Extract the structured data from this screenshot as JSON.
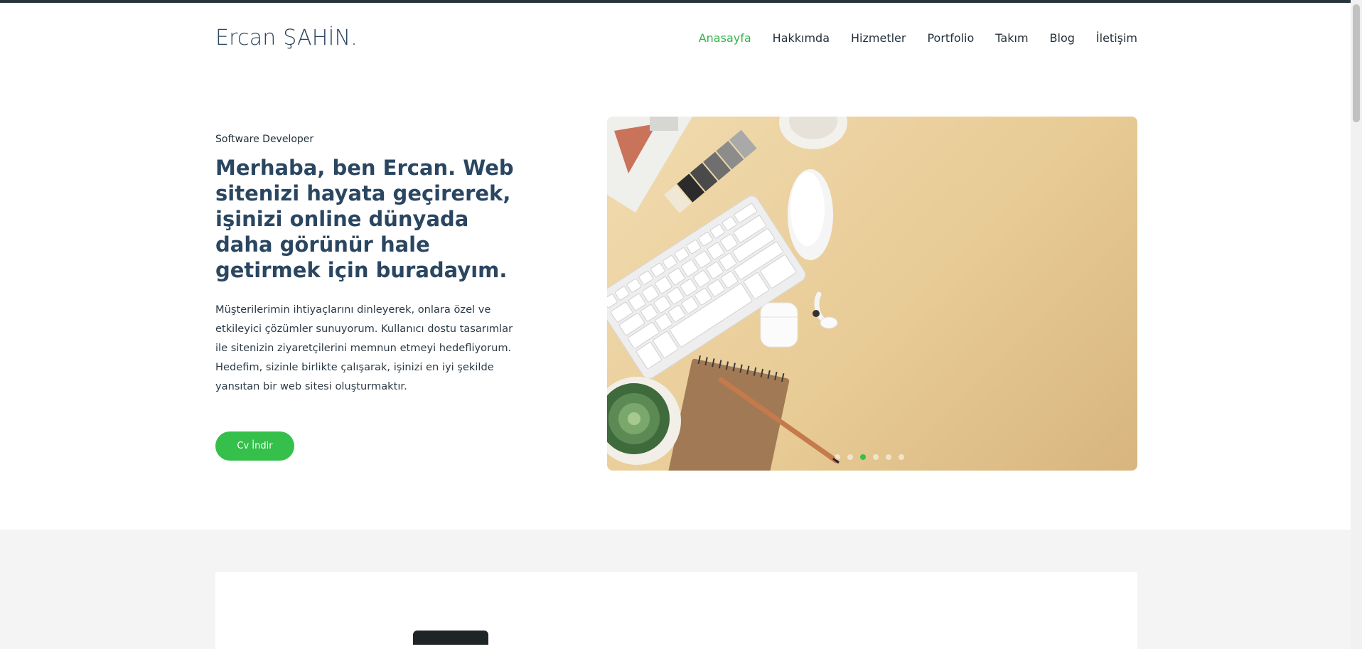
{
  "brand": "Ercan ŞAHİN.",
  "nav": {
    "items": [
      "Anasayfa",
      "Hakkımda",
      "Hizmetler",
      "Portfolio",
      "Takım",
      "Blog",
      "İletişim"
    ],
    "active": "Anasayfa"
  },
  "hero": {
    "subtitle": "Software Developer",
    "headline": "Merhaba, ben Ercan. Web sitenizi hayata geçirerek, işinizi online dünyada daha görünür hale getirmek için buradayım.",
    "lead": "Müşterilerimin ihtiyaçlarını dinleyerek, onlara özel ve etkileyici çözümler sunuyorum. Kullanıcı dostu tasarımlar ile sitenizin ziyaretçilerini memnun etmeyi hedefliyorum. Hedefim, sizinle birlikte çalışarak, işinizi en iyi şekilde yansıtan bir web sitesi oluşturmaktır.",
    "cta": "Cv İndir"
  },
  "slider": {
    "dot_count": 6,
    "active_index": 2
  },
  "colors": {
    "accent": "#34c04a",
    "heading": "#2a4661",
    "top_bar": "#26343b"
  }
}
